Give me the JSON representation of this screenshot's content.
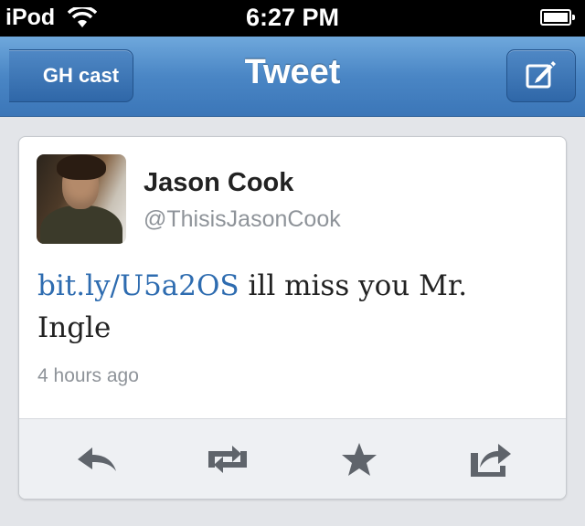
{
  "status_bar": {
    "carrier": "iPod",
    "time": "6:27 PM",
    "battery_level": 0.9
  },
  "nav": {
    "back_label": "GH cast",
    "title": "Tweet",
    "compose_icon": "compose-icon"
  },
  "tweet": {
    "author_name": "Jason Cook",
    "handle": "@ThisisJasonCook",
    "link": "bit.ly/U5a2OS",
    "text": " ill miss you Mr. Ingle",
    "timestamp": "4 hours ago"
  },
  "actions": {
    "reply_icon": "reply-icon",
    "retweet_icon": "retweet-icon",
    "favorite_icon": "star-icon",
    "share_icon": "share-icon"
  },
  "colors": {
    "nav_blue": "#4a86c5",
    "link_blue": "#2e6cb0",
    "icon_gray": "#5f646b"
  }
}
